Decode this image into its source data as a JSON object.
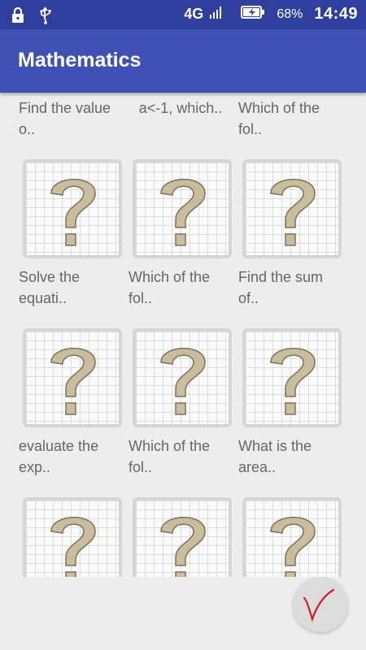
{
  "status_bar": {
    "network": "4G",
    "battery": "68%",
    "time": "14:49",
    "icons": [
      "lock-icon",
      "usb-icon",
      "signal-icon",
      "battery-icon"
    ]
  },
  "app_bar": {
    "title": "Mathematics"
  },
  "questions": [
    {
      "label": "Find the value o.."
    },
    {
      "label": "a<-1, which.."
    },
    {
      "label": "Which of the fol.."
    },
    {
      "label": "Solve the equati.."
    },
    {
      "label": "Which of the fol.."
    },
    {
      "label": "Find the sum of.."
    },
    {
      "label": "evaluate the exp.."
    },
    {
      "label": "Which of the fol.."
    },
    {
      "label": "What is the area.."
    },
    {
      "label": ""
    },
    {
      "label": ""
    },
    {
      "label": ""
    }
  ],
  "fab": {
    "icon": "checkmark-v-icon"
  },
  "colors": {
    "status_bar": "#2f3f9e",
    "app_bar": "#3f51b5",
    "question_mark": "#c9bd9c",
    "fab_mark": "#d11a2a"
  }
}
